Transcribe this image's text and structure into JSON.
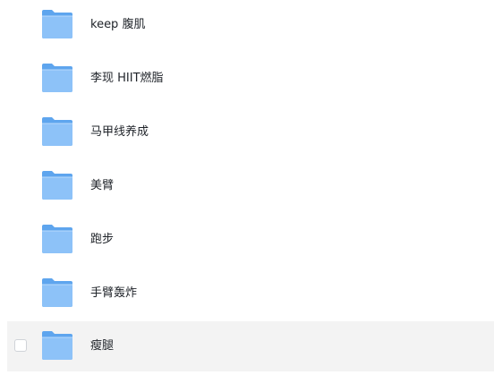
{
  "files": [
    {
      "name": "keep 腹肌",
      "icon": "folder-icon"
    },
    {
      "name": "李现 HIIT燃脂",
      "icon": "folder-icon"
    },
    {
      "name": "马甲线养成",
      "icon": "folder-icon"
    },
    {
      "name": "美臂",
      "icon": "folder-icon"
    },
    {
      "name": "跑步",
      "icon": "folder-icon"
    },
    {
      "name": "手臂轰炸",
      "icon": "folder-icon"
    },
    {
      "name": "瘦腿",
      "icon": "folder-icon"
    }
  ],
  "colors": {
    "folder_back": "#5ea5ee",
    "folder_front": "#8dc2f8",
    "hover_bg": "#f3f3f3",
    "text": "#1f2329"
  }
}
